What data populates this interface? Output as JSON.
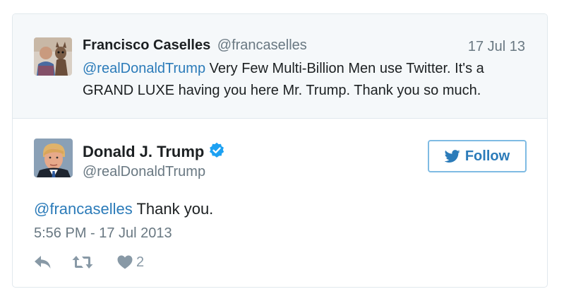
{
  "parent_tweet": {
    "author_name": "Francisco Caselles",
    "author_handle": "@francaselles",
    "date": "17 Jul 13",
    "text_mention": "@realDonaldTrump",
    "text_body": " Very Few Multi-Billion Men use Twitter. It's a GRAND LUXE having you here Mr. Trump. Thank you so much."
  },
  "main_tweet": {
    "author_name": "Donald J. Trump",
    "author_handle": "@realDonaldTrump",
    "verified": true,
    "text_mention": "@francaselles",
    "text_body": " Thank you.",
    "timestamp": "5:56 PM - 17 Jul 2013",
    "like_count": "2"
  },
  "follow_button": {
    "label": "Follow"
  },
  "icons": {
    "verified": "verified-badge-icon",
    "follow": "twitter-bird-icon",
    "reply": "reply-icon",
    "retweet": "retweet-icon",
    "like": "heart-icon"
  },
  "colors": {
    "accent": "#2b7bb9",
    "verified": "#1da1f2",
    "muted": "#697882",
    "parent_bg": "#f5f8fa"
  }
}
